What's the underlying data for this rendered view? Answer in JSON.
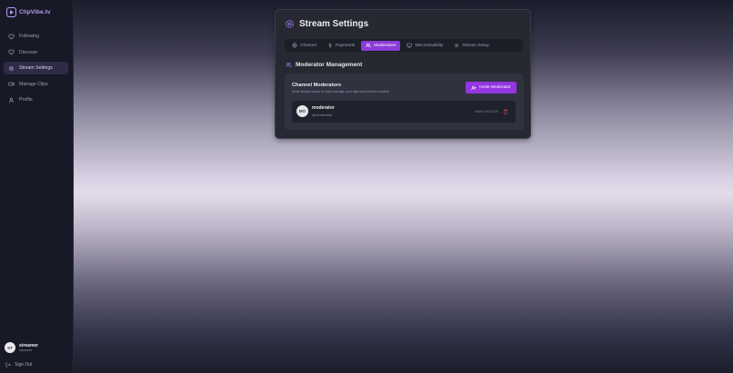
{
  "app": {
    "name": "ClipVibe.tv"
  },
  "sidebar": {
    "items": [
      {
        "label": "Following",
        "icon": "heart-icon",
        "active": false
      },
      {
        "label": "Discover",
        "icon": "heart-icon",
        "active": false
      },
      {
        "label": "Stream Settings",
        "icon": "gear-icon",
        "active": true
      },
      {
        "label": "Manage Clips",
        "icon": "video-icon",
        "active": false
      },
      {
        "label": "Profile",
        "icon": "user-icon",
        "active": false
      }
    ],
    "user": {
      "initials": "ST",
      "name": "streamer",
      "handle": "streamer"
    },
    "signout_label": "Sign Out"
  },
  "settings": {
    "title": "Stream Settings",
    "tabs": [
      {
        "label": "Channel",
        "icon": "globe-icon",
        "active": false
      },
      {
        "label": "Payments",
        "icon": "dollar-icon",
        "active": false
      },
      {
        "label": "Moderators",
        "icon": "users-icon",
        "active": true
      },
      {
        "label": "Discoverability",
        "icon": "monitor-icon",
        "active": false
      },
      {
        "label": "Stream Setup",
        "icon": "gear-icon",
        "active": false
      }
    ],
    "section_title": "Moderator Management",
    "panel": {
      "title": "Channel Moderators",
      "subtitle": "Invite trusted users to help manage your clips and stream content",
      "invite_label": "Invite Moderator",
      "moderators": [
        {
          "initials": "MO",
          "name": "moderator",
          "handle": "@moderator",
          "added": "Added 4/10/2025"
        }
      ]
    }
  },
  "colors": {
    "accent": "#9335e0",
    "active_tab": "#8b3bd9",
    "logo": "#b69cf5",
    "delete": "#e0525a"
  }
}
